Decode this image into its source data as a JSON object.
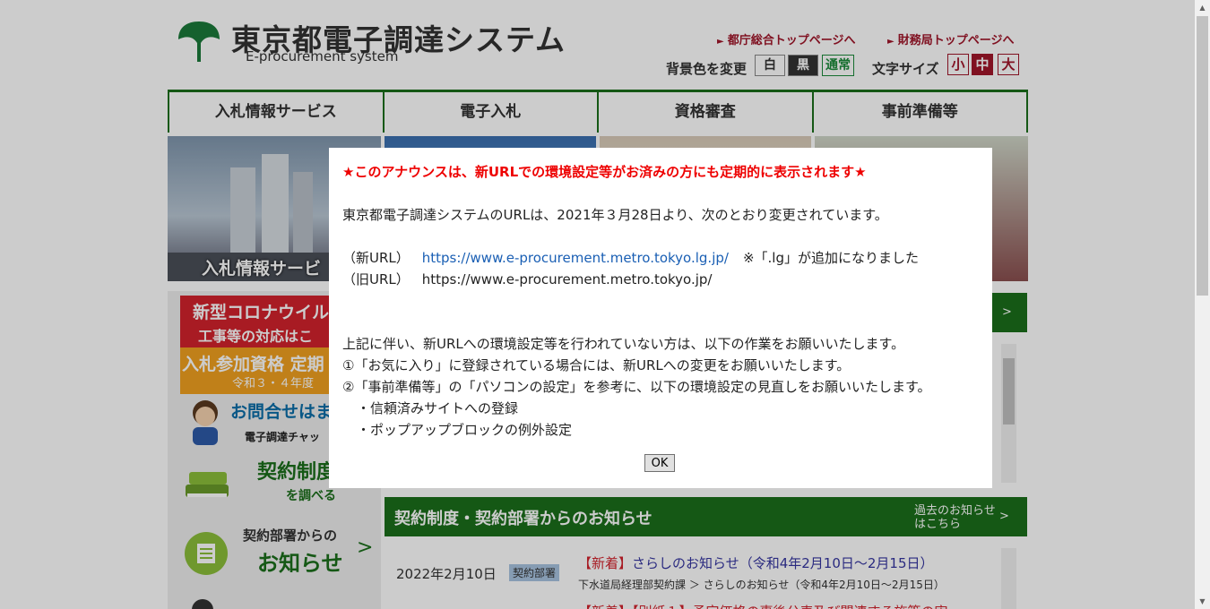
{
  "header": {
    "logo_title": "東京都電子調達システム",
    "logo_subtitle": "E-procurement system",
    "link_metro": "都庁総合トップページへ",
    "link_finance": "財務局トップページへ",
    "bg_label": "背景色を変更",
    "bg_options": [
      "白",
      "黒",
      "通常"
    ],
    "size_label": "文字サイズ",
    "size_options": [
      "小",
      "中",
      "大"
    ]
  },
  "nav": {
    "items": [
      "入札情報サービス",
      "電子入札",
      "資格審査",
      "事前準備等"
    ]
  },
  "banners": {
    "first_label": "入札情報サービ"
  },
  "left": {
    "corona_line1": "新型コロナウイル",
    "corona_line2": "工事等の対応はこ",
    "qual_line1": "入札参加資格 定期",
    "qual_line2": "令和３・４年度",
    "chat_line1": "お問合せはま",
    "chat_line2": "電子調達チャッ",
    "keiyaku_line1": "契約制度",
    "keiyaku_line2": "を調べる",
    "oshirase_line1": "契約部署からの",
    "oshirase_line2": "お知らせ",
    "oshirase_chev": ">"
  },
  "right_box": {
    "chevron": ">"
  },
  "section": {
    "title": "契約制度・契約部署からのお知らせ",
    "past_line1": "過去のお知らせ",
    "past_line2": "はこちら",
    "chevron": ">"
  },
  "news": {
    "date": "2022年2月10日",
    "tag": "契約部署",
    "new_mark": "【新着】",
    "title": "さらしのお知らせ（令和4年2月10日～2月15日）",
    "source": "下水道局経理部契約課 ＞ さらしのお知らせ（令和4年2月10日～2月15日）",
    "next_partial": "【新着】【別紙１】予定価格の事後公表及び関連する施策の実"
  },
  "modal": {
    "alert": "★このアナウンスは、新URLでの環境設定等がお済みの方にも定期的に表示されます★",
    "intro": "東京都電子調達システムのURLは、2021年３月28日より、次のとおり変更されています。",
    "new_label": "（新URL）",
    "new_url": "https://www.e-procurement.metro.tokyo.lg.jp/",
    "new_note": "※「.lg」が追加になりました",
    "old_label": "（旧URL）",
    "old_url": "https://www.e-procurement.metro.tokyo.jp/",
    "line1": "上記に伴い、新URLへの環境設定等を行われていない方は、以下の作業をお願いいたします。",
    "line2": "①「お気に入り」に登録されている場合には、新URLへの変更をお願いいたします。",
    "line3": "②「事前準備等」の「パソコンの設定」を参考に、以下の環境設定の見直しをお願いいたします。",
    "bullet1": "・信頼済みサイトへの登録",
    "bullet2": "・ポップアップブロックの例外設定",
    "ok_label": "OK"
  },
  "colors": {
    "brand_green": "#1b6e1b",
    "accent_red": "#a0162a",
    "alert_red": "#ee0000",
    "link_blue": "#1a5fb4"
  }
}
